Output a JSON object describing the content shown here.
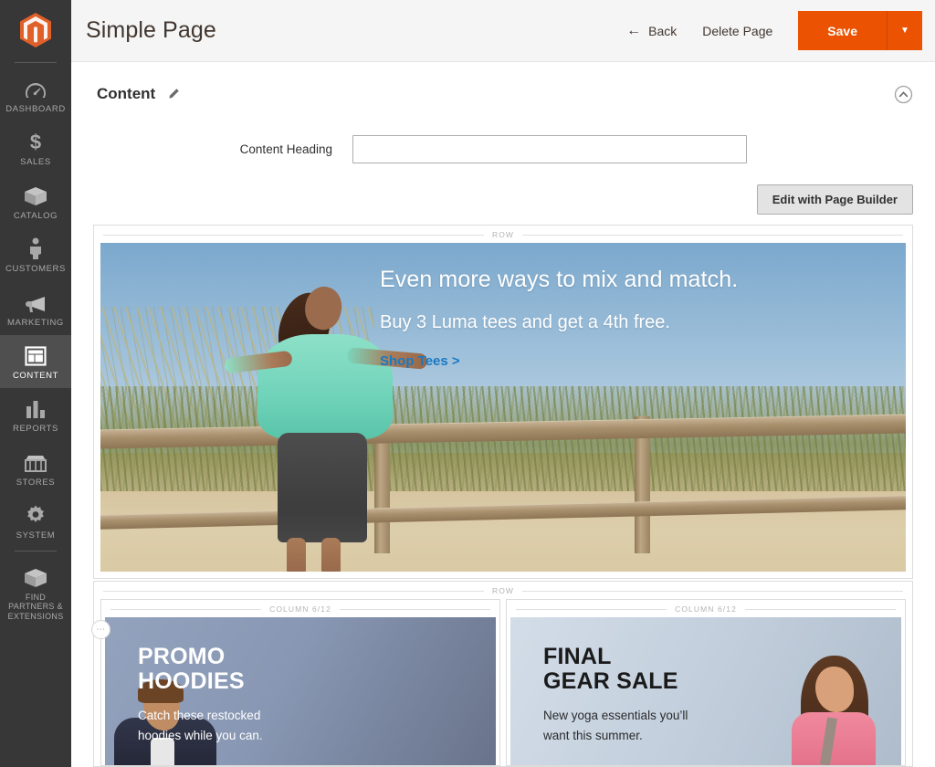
{
  "sidebar": {
    "logo_icon": "magento-logo-icon",
    "items": [
      {
        "label": "Dashboard",
        "icon": "dashboard-gauge-icon",
        "active": false
      },
      {
        "label": "Sales",
        "icon": "dollar-sign-icon",
        "active": false
      },
      {
        "label": "Catalog",
        "icon": "box-icon",
        "active": false
      },
      {
        "label": "Customers",
        "icon": "person-icon",
        "active": false
      },
      {
        "label": "Marketing",
        "icon": "megaphone-icon",
        "active": false
      },
      {
        "label": "Content",
        "icon": "layout-window-icon",
        "active": true
      },
      {
        "label": "Reports",
        "icon": "bar-chart-icon",
        "active": false
      },
      {
        "label": "Stores",
        "icon": "storefront-icon",
        "active": false
      },
      {
        "label": "System",
        "icon": "gear-icon",
        "active": false
      },
      {
        "label": "Find Partners & Extensions",
        "icon": "box-open-icon",
        "active": false
      }
    ]
  },
  "header": {
    "title": "Simple Page",
    "back_label": "Back",
    "back_icon": "arrow-left-icon",
    "delete_label": "Delete Page",
    "save_label": "Save",
    "save_caret_icon": "chevron-down-icon",
    "save_color": "#eb5202"
  },
  "section": {
    "title": "Content",
    "edit_icon": "pencil-icon",
    "collapse_icon": "chevron-up-circle-icon",
    "field_label": "Content Heading",
    "field_value": "",
    "field_placeholder": "",
    "page_builder_button": "Edit with Page Builder"
  },
  "stage": {
    "row1_label": "Row",
    "row2_label": "Row",
    "column_left_label": "Column 6/12",
    "column_right_label": "Column 6/12",
    "drag_handle_icon": "drag-dots-icon",
    "hero": {
      "heading": "Even more ways to mix and match.",
      "subheading": "Buy 3 Luma tees and get a 4th free.",
      "cta_label": "Shop Tees >",
      "cta_color": "#1979c3"
    },
    "promo_left": {
      "heading_line1": "PROMO",
      "heading_line2": "HOODIES",
      "sub_line1": "Catch these restocked",
      "sub_line2": "hoodies while you can."
    },
    "promo_right": {
      "heading_line1": "FINAL",
      "heading_line2": "GEAR SALE",
      "sub_line1": "New yoga essentials you’ll",
      "sub_line2": "want this summer."
    }
  }
}
